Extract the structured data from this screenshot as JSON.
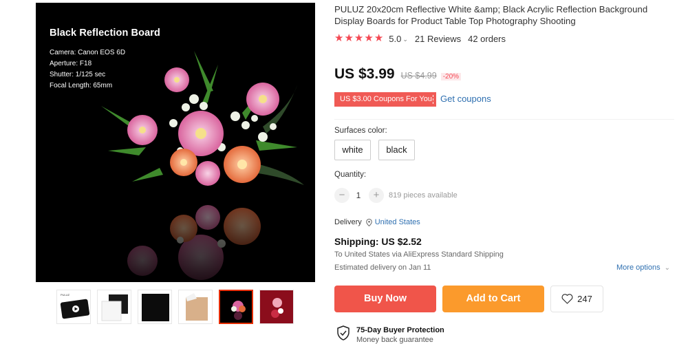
{
  "gallery": {
    "main_image": {
      "overlay_title": "Black Reflection Board",
      "overlay_lines": [
        "Camera: Canon EOS 6D",
        "Aperture: F18",
        "Shutter: 1/125 sec",
        "Focal Length: 65mm"
      ]
    },
    "thumbnails": [
      {
        "logo_text": "PULUZ"
      },
      {},
      {},
      {},
      {
        "selected": true
      },
      {}
    ]
  },
  "product": {
    "title": "PULUZ 20x20cm Reflective White &amp; Black Acrylic Reflection Background Display Boards for Product Table Top Photography Shooting",
    "rating": "5.0",
    "stars": 5,
    "reviews": "21 Reviews",
    "orders": "42 orders"
  },
  "price": {
    "current": "US $3.99",
    "original": "US $4.99",
    "discount": "-20%"
  },
  "coupon": {
    "label": "US $3.00 Coupons For You",
    "link": "Get coupons"
  },
  "options": {
    "surface_label": "Surfaces color:",
    "colors": [
      "white",
      "black"
    ]
  },
  "quantity": {
    "label": "Quantity:",
    "minus": "−",
    "plus": "+",
    "value": "1",
    "available": "819 pieces available"
  },
  "delivery": {
    "label": "Delivery",
    "country": "United States"
  },
  "shipping": {
    "cost": "Shipping: US $2.52",
    "to_prefix": "To United States via AliExpress Standard Shipping",
    "estimated": "Estimated delivery on Jan 11",
    "more_options": "More options"
  },
  "actions": {
    "buy_now": "Buy Now",
    "add_to_cart": "Add to Cart",
    "wishlist_count": "247"
  },
  "protection": {
    "title": "75-Day Buyer Protection",
    "subtitle": "Money back guarantee"
  },
  "colors": {
    "star": "#f44853",
    "buy_now": "#f0554a",
    "add_to_cart": "#fb9a2c",
    "coupon_bg": "#f05a55",
    "link": "#2e6fb0",
    "selected_thumb_border": "#e62e04"
  }
}
